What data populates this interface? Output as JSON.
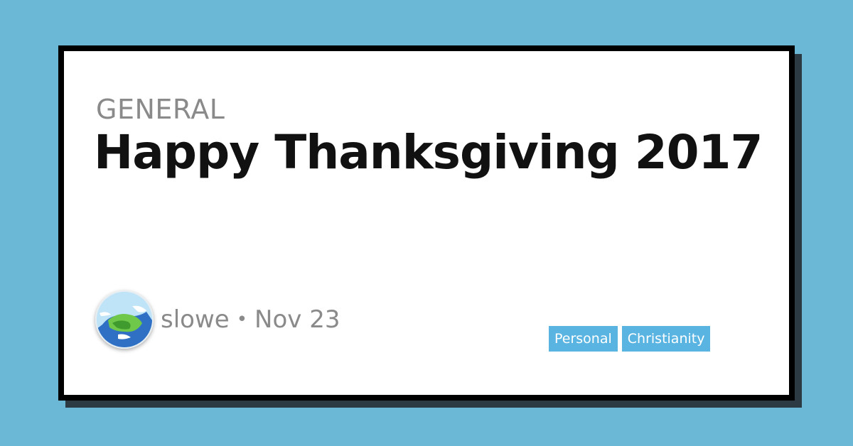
{
  "post": {
    "category": "GENERAL",
    "title": "Happy Thanksgiving 2017",
    "author": "slowe",
    "separator": "•",
    "date": "Nov 23",
    "tags": [
      "Personal",
      "Christianity"
    ]
  },
  "colors": {
    "background": "#6bb7d6",
    "card": "#ffffff",
    "card_border": "#000000",
    "card_shadow": "#2c3a44",
    "tag_background": "#5ab4e2",
    "muted_text": "#8a8a8a"
  },
  "icons": {
    "avatar": "earth-cartoon-avatar"
  }
}
